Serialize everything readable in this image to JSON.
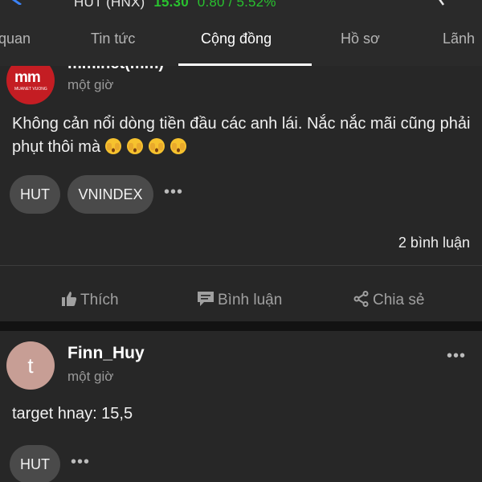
{
  "header": {
    "symbol": "HUT (HNX)",
    "price": "15.30",
    "change": "0.80 / 5.52%",
    "price_color": "#29c22f",
    "back_icon": "back-arrow-icon",
    "search_icon": "search-icon"
  },
  "tabs": [
    {
      "label": "Tổng quan",
      "visible": "quan"
    },
    {
      "label": "Tin tức"
    },
    {
      "label": "Cộng đồng",
      "active": true
    },
    {
      "label": "Hồ sơ"
    },
    {
      "label": "Lãnh"
    }
  ],
  "posts": [
    {
      "author": "mm.net(mm)",
      "time": "một giờ",
      "body": "Không cản nổi dòng tiền đầu các anh lái. Nắc nắc mãi cũng phải phụt thôi mà",
      "emoji": [
        "face-with-peeking-eye",
        "face-with-peeking-eye",
        "face-with-peeking-eye",
        "face-with-peeking-eye"
      ],
      "tags": [
        "HUT",
        "VNINDEX"
      ],
      "comments": "2 bình luận",
      "actions": {
        "like": "Thích",
        "comment": "Bình luận",
        "share": "Chia sẻ"
      }
    },
    {
      "author": "Finn_Huy",
      "avatar_letter": "t",
      "avatar_color": "#c79e95",
      "time": "một giờ",
      "body": "target hnay: 15,5",
      "tags": [
        "HUT"
      ]
    }
  ],
  "more_label": "•••"
}
